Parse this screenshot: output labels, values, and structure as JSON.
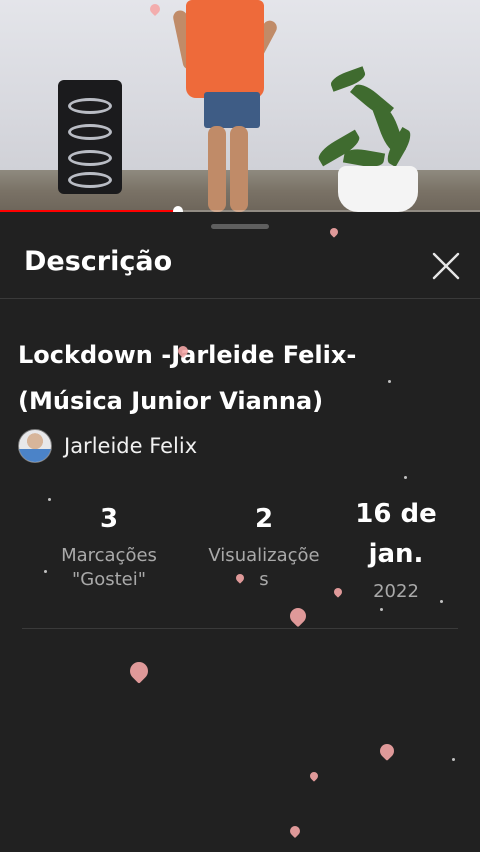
{
  "player": {
    "progress_fraction": 0.37,
    "accent_color": "#ff0000"
  },
  "sheet": {
    "title": "Descrição",
    "close_icon": "close-icon"
  },
  "video": {
    "title": "Lockdown -Jarleide Felix- (Música Junior  Vianna)"
  },
  "channel": {
    "name": "Jarleide Felix"
  },
  "stats": {
    "likes_count": "3",
    "likes_label": "Marcações \"Gostei\"",
    "views_count": "2",
    "views_label": "Visualizaçõe s",
    "date_day_month": "16 de jan.",
    "date_year": "2022"
  }
}
